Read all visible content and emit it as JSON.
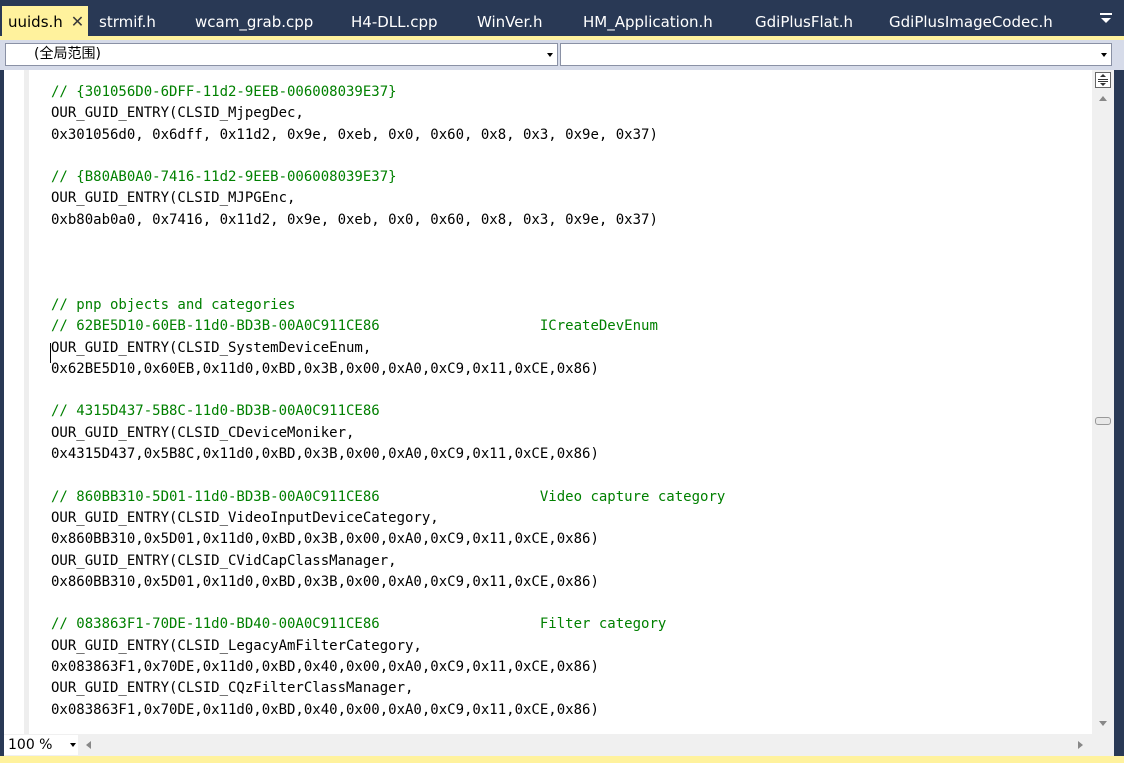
{
  "tabs": [
    {
      "label": "uuids.h",
      "active": true
    },
    {
      "label": "strmif.h"
    },
    {
      "label": "wcam_grab.cpp"
    },
    {
      "label": "H4-DLL.cpp"
    },
    {
      "label": "WinVer.h"
    },
    {
      "label": "HM_Application.h"
    },
    {
      "label": "GdiPlusFlat.h"
    },
    {
      "label": "GdiPlusImageCodec.h"
    }
  ],
  "close_glyph": "✕",
  "scope_combo": {
    "value": "(全局范围)"
  },
  "member_combo": {
    "value": ""
  },
  "code_lines": [
    {
      "t": "// {301056D0-6DFF-11d2-9EEB-006008039E37}",
      "c": true
    },
    {
      "t": "OUR_GUID_ENTRY(CLSID_MjpegDec,"
    },
    {
      "t": "0x301056d0, 0x6dff, 0x11d2, 0x9e, 0xeb, 0x0, 0x60, 0x8, 0x3, 0x9e, 0x37)"
    },
    {
      "t": ""
    },
    {
      "t": "// {B80AB0A0-7416-11d2-9EEB-006008039E37}",
      "c": true
    },
    {
      "t": "OUR_GUID_ENTRY(CLSID_MJPGEnc,"
    },
    {
      "t": "0xb80ab0a0, 0x7416, 0x11d2, 0x9e, 0xeb, 0x0, 0x60, 0x8, 0x3, 0x9e, 0x37)"
    },
    {
      "t": ""
    },
    {
      "t": ""
    },
    {
      "t": ""
    },
    {
      "t": "// pnp objects and categories",
      "c": true
    },
    {
      "t": "// 62BE5D10-60EB-11d0-BD3B-00A0C911CE86                   ICreateDevEnum",
      "c": true
    },
    {
      "t": "OUR_GUID_ENTRY(CLSID_SystemDeviceEnum,"
    },
    {
      "t": "0x62BE5D10,0x60EB,0x11d0,0xBD,0x3B,0x00,0xA0,0xC9,0x11,0xCE,0x86)"
    },
    {
      "t": ""
    },
    {
      "t": "// 4315D437-5B8C-11d0-BD3B-00A0C911CE86",
      "c": true
    },
    {
      "t": "OUR_GUID_ENTRY(CLSID_CDeviceMoniker,"
    },
    {
      "t": "0x4315D437,0x5B8C,0x11d0,0xBD,0x3B,0x00,0xA0,0xC9,0x11,0xCE,0x86)"
    },
    {
      "t": ""
    },
    {
      "t": "// 860BB310-5D01-11d0-BD3B-00A0C911CE86                   Video capture category",
      "c": true
    },
    {
      "t": "OUR_GUID_ENTRY(CLSID_VideoInputDeviceCategory,"
    },
    {
      "t": "0x860BB310,0x5D01,0x11d0,0xBD,0x3B,0x00,0xA0,0xC9,0x11,0xCE,0x86)"
    },
    {
      "t": "OUR_GUID_ENTRY(CLSID_CVidCapClassManager,"
    },
    {
      "t": "0x860BB310,0x5D01,0x11d0,0xBD,0x3B,0x00,0xA0,0xC9,0x11,0xCE,0x86)"
    },
    {
      "t": ""
    },
    {
      "t": "// 083863F1-70DE-11d0-BD40-00A0C911CE86                   Filter category",
      "c": true
    },
    {
      "t": "OUR_GUID_ENTRY(CLSID_LegacyAmFilterCategory,"
    },
    {
      "t": "0x083863F1,0x70DE,0x11d0,0xBD,0x40,0x00,0xA0,0xC9,0x11,0xCE,0x86)"
    },
    {
      "t": "OUR_GUID_ENTRY(CLSID_CQzFilterClassManager,"
    },
    {
      "t": "0x083863F1,0x70DE,0x11d0,0xBD,0x40,0x00,0xA0,0xC9,0x11,0xCE,0x86)"
    }
  ],
  "zoom": {
    "value": "100 %"
  },
  "colors": {
    "chrome_bg": "#293955",
    "active_tab": "#fff29d",
    "comment": "#008000"
  }
}
